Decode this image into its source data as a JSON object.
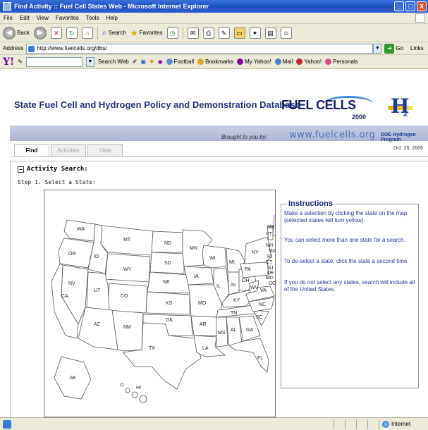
{
  "window": {
    "title": "Find Activity :: Fuel Cell States Web - Microsoft Internet Explorer",
    "buttons": [
      "_",
      "□",
      "X"
    ]
  },
  "menu": [
    "File",
    "Edit",
    "View",
    "Favorites",
    "Tools",
    "Help"
  ],
  "toolbar": {
    "back": "Back",
    "search": "Search",
    "favorites": "Favorites"
  },
  "address": {
    "label": "Address",
    "url": "http://www.fuelcells.org/dbs/",
    "go": "Go",
    "links": "Links"
  },
  "yahoo": {
    "logo": "Y!",
    "search_web": "Search Web",
    "items": [
      {
        "label": "Football",
        "color": "#5a8fd6"
      },
      {
        "label": "Bookmarks",
        "color": "#d9a72a"
      },
      {
        "label": "My Yahoo!",
        "color": "#7b0099"
      },
      {
        "label": "Mail",
        "color": "#4a7fc8"
      },
      {
        "label": "Yahoo!",
        "color": "#c0282d"
      },
      {
        "label": "Personals",
        "color": "#d94d7a"
      }
    ]
  },
  "page": {
    "title": "State Fuel Cell and Hydrogen Policy and Demonstration Database",
    "logo_fuelcells": "FUEL CELLS",
    "logo_2000": "2000",
    "logo_h": "H",
    "logo_2": "2",
    "brought_by": "Brought to you by:",
    "site_url": "www.fuelcells.org",
    "doe": "DOE Hydrogen Program",
    "date": "Oct. 25, 2006",
    "tabs": [
      {
        "label": "Find",
        "active": true
      },
      {
        "label": "Activities",
        "active": false
      },
      {
        "label": "View",
        "active": false
      }
    ],
    "collapse_symbol": "−",
    "activity_search": "Activity Search:",
    "step1": "Step 1.  Select a State:"
  },
  "map": {
    "states": [
      "WA",
      "OR",
      "ID",
      "MT",
      "ND",
      "SD",
      "MN",
      "WI",
      "MI",
      "NY",
      "VT",
      "ME",
      "NH",
      "MA",
      "RI",
      "CT",
      "NJ",
      "DE",
      "MD",
      "PA",
      "OH",
      "IN",
      "IL",
      "IA",
      "NE",
      "WY",
      "NV",
      "UT",
      "CO",
      "KS",
      "MO",
      "KY",
      "WV",
      "VA",
      "DC",
      "NC",
      "TN",
      "SC",
      "GA",
      "AL",
      "MS",
      "AR",
      "LA",
      "OK",
      "TX",
      "NM",
      "AZ",
      "CA",
      "FL",
      "AK",
      "HI"
    ]
  },
  "instructions": {
    "title": "Instructions",
    "paragraphs": [
      "Make a selection by clicking the state on the map (selected states will turn yellow).",
      "You can select more than one state for a search.",
      "To de-select a state, click the state a second time.",
      "If you do not select any states, search will include all of the United States."
    ]
  },
  "status": {
    "zone": "Internet"
  }
}
